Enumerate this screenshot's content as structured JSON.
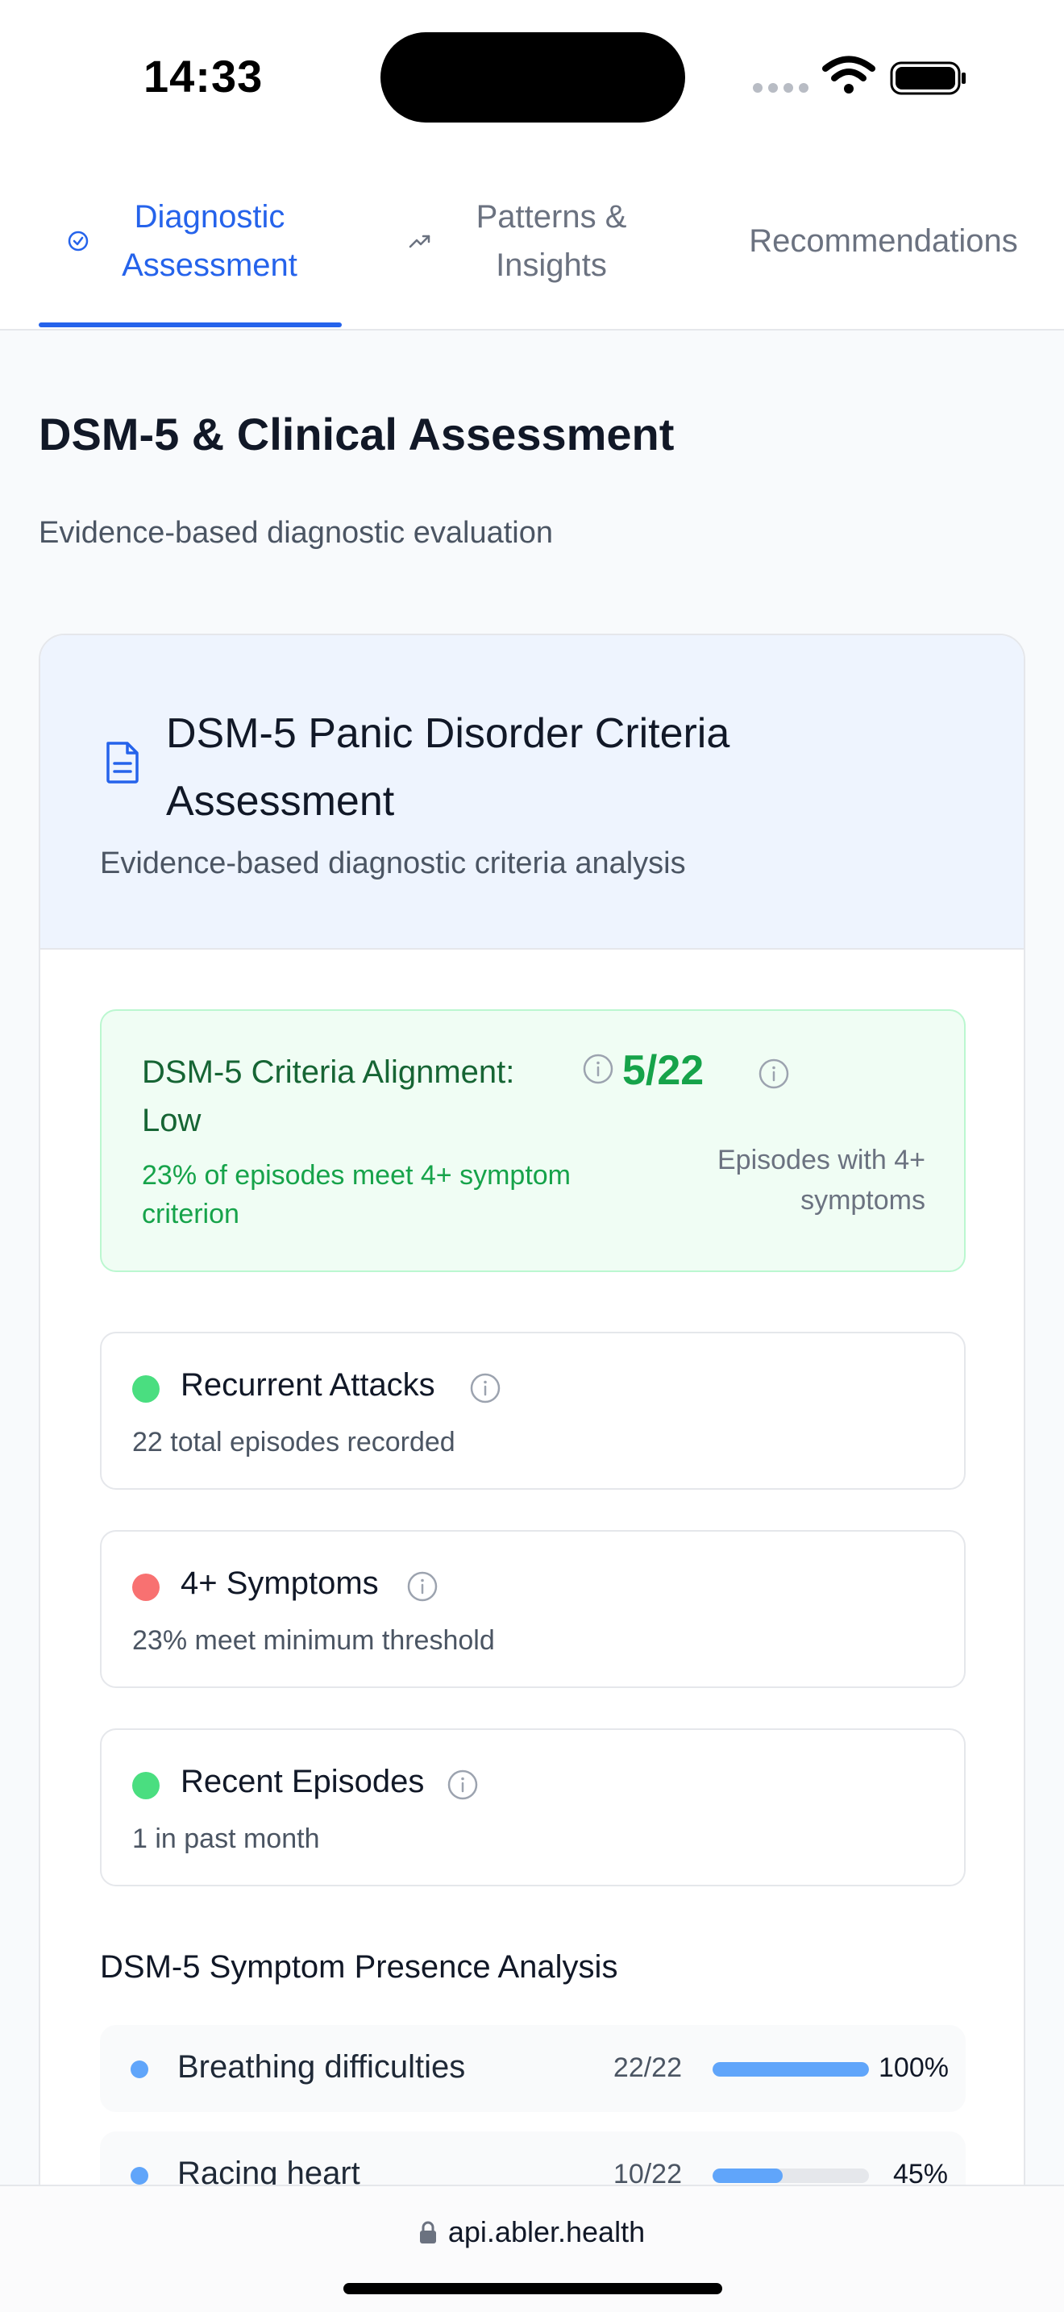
{
  "status_bar": {
    "time": "14:33"
  },
  "tabs": [
    {
      "label": "Diagnostic Assessment",
      "icon": "check-circle-icon",
      "active": true
    },
    {
      "label": "Patterns & Insights",
      "icon": "trending-up-icon",
      "active": false
    },
    {
      "label": "Recommendations",
      "active": false
    }
  ],
  "page": {
    "title": "DSM-5 & Clinical Assessment",
    "subtitle": "Evidence-based diagnostic evaluation"
  },
  "card": {
    "title": "DSM-5 Panic Disorder Criteria Assessment",
    "subtitle": "Evidence-based diagnostic criteria analysis",
    "icon": "document-icon"
  },
  "alignment": {
    "title": "DSM-5 Criteria Alignment: Low",
    "detail": "23% of episodes meet 4+ symptom criterion",
    "score": "5/22",
    "score_label": "Episodes with 4+ symptoms"
  },
  "criteria": [
    {
      "title": "Recurrent Attacks",
      "subtitle": "22 total episodes recorded",
      "status_color": "#4ade80"
    },
    {
      "title": "4+ Symptoms",
      "subtitle": "23% meet minimum threshold",
      "status_color": "#f87171"
    },
    {
      "title": "Recent Episodes",
      "subtitle": "1 in past month",
      "status_color": "#4ade80"
    }
  ],
  "symptoms": {
    "title": "DSM-5 Symptom Presence Analysis",
    "rows": [
      {
        "name": "Breathing difficulties",
        "count": "22/22",
        "percent": "100%",
        "fraction": 1.0
      },
      {
        "name": "Racing heart",
        "count": "10/22",
        "percent": "45%",
        "fraction": 0.45
      }
    ]
  },
  "browser": {
    "url": "api.abler.health"
  },
  "colors": {
    "accent": "#2563eb",
    "success": "#16a34a",
    "danger": "#f87171",
    "bar": "#60a5fa"
  }
}
